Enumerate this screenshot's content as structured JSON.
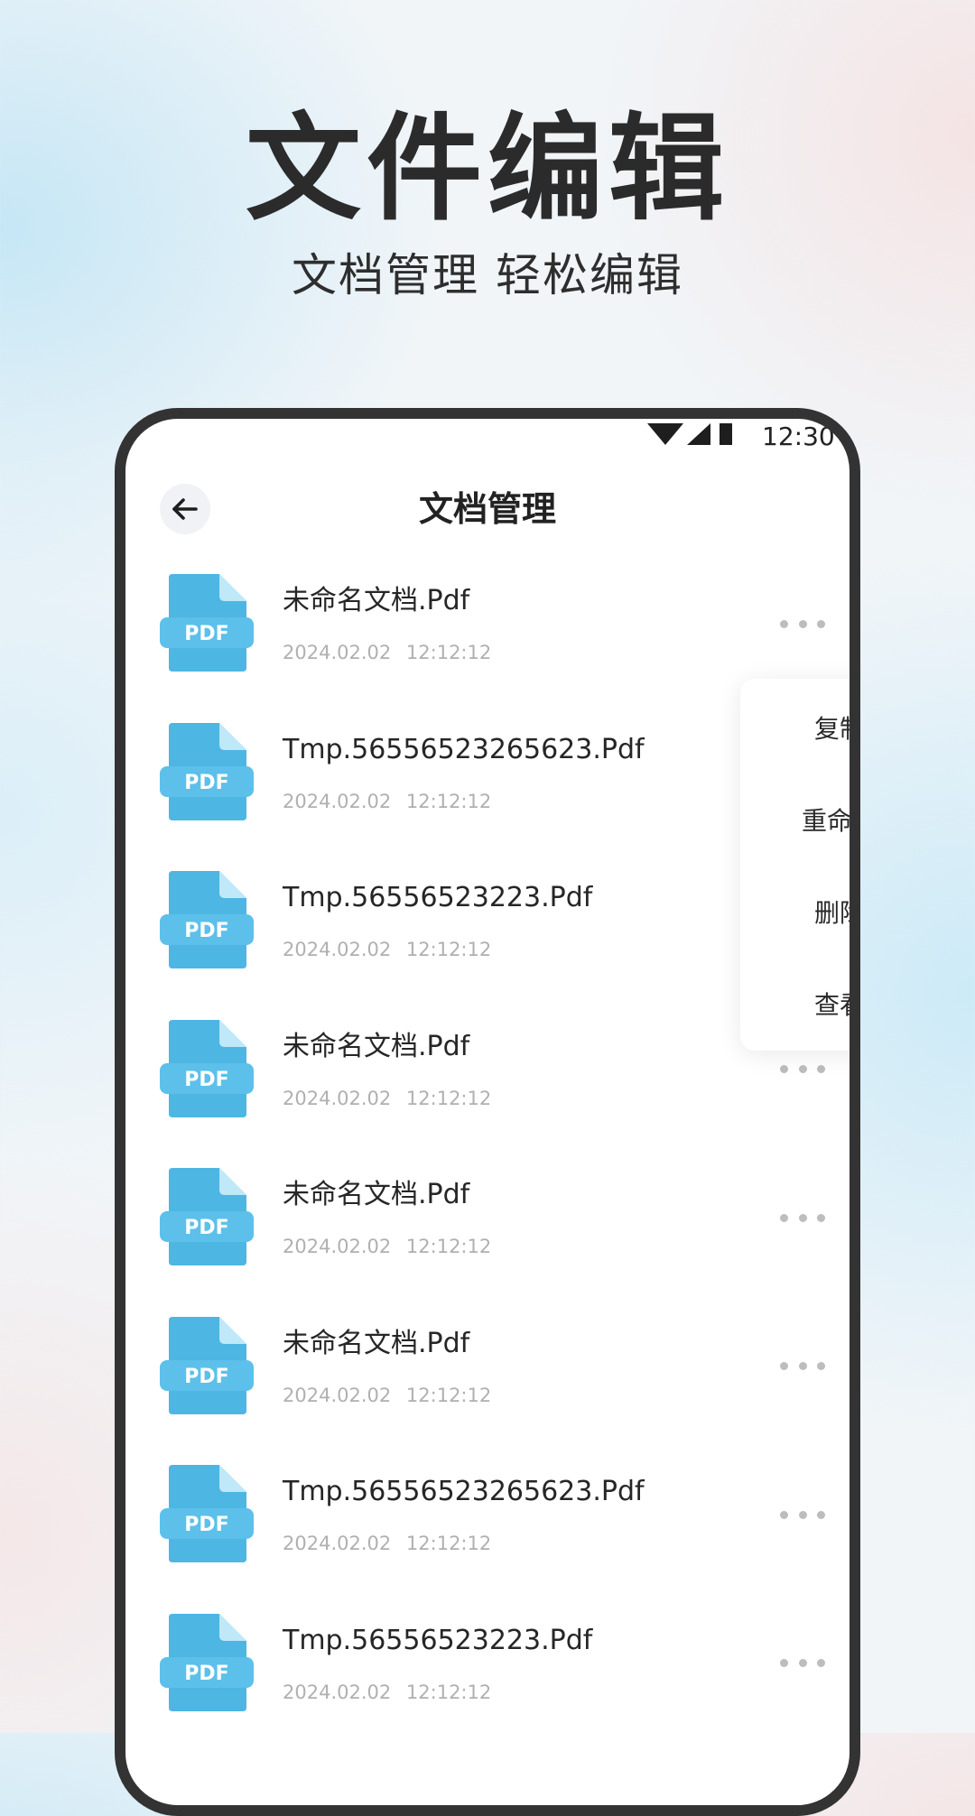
{
  "hero": {
    "title": "文件编辑",
    "subtitle": "文档管理 轻松编辑"
  },
  "status_bar": {
    "time": "12:30"
  },
  "screen": {
    "title": "文档管理",
    "back_icon": "back-arrow-icon"
  },
  "files": [
    {
      "name": "未命名文档.Pdf",
      "date": "2024.02.02 12:12:12",
      "icon_label": "PDF"
    },
    {
      "name": "Tmp.56556523265623.Pdf",
      "date": "2024.02.02 12:12:12",
      "icon_label": "PDF"
    },
    {
      "name": "Tmp.56556523223.Pdf",
      "date": "2024.02.02 12:12:12",
      "icon_label": "PDF"
    },
    {
      "name": "未命名文档.Pdf",
      "date": "2024.02.02 12:12:12",
      "icon_label": "PDF"
    },
    {
      "name": "未命名文档.Pdf",
      "date": "2024.02.02 12:12:12",
      "icon_label": "PDF"
    },
    {
      "name": "未命名文档.Pdf",
      "date": "2024.02.02 12:12:12",
      "icon_label": "PDF"
    },
    {
      "name": "Tmp.56556523265623.Pdf",
      "date": "2024.02.02 12:12:12",
      "icon_label": "PDF"
    },
    {
      "name": "Tmp.56556523223.Pdf",
      "date": "2024.02.02 12:12:12",
      "icon_label": "PDF"
    }
  ],
  "context_menu": {
    "items": [
      "复制",
      "重命名",
      "删除",
      "查看"
    ]
  },
  "colors": {
    "pdf_icon_blue": "#4db6e2",
    "pdf_icon_light": "#bfe8f8",
    "title_text": "#2b2b2b",
    "date_text": "#b0b0b0"
  }
}
